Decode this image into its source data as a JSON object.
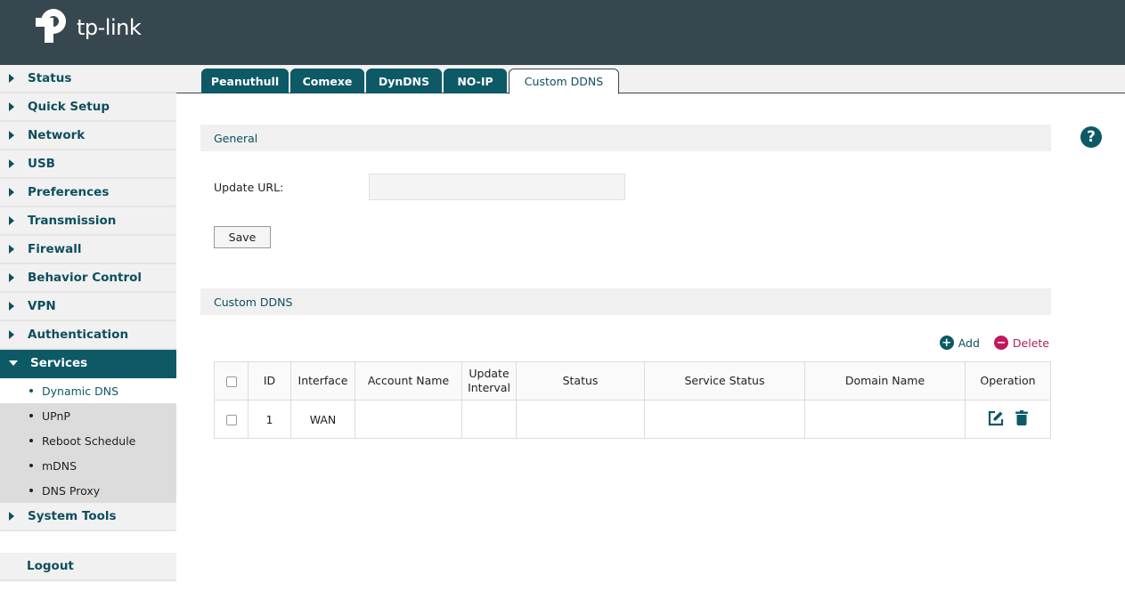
{
  "brand": {
    "name": "tp-link"
  },
  "sidebar": {
    "items": [
      {
        "label": "Status"
      },
      {
        "label": "Quick Setup"
      },
      {
        "label": "Network"
      },
      {
        "label": "USB"
      },
      {
        "label": "Preferences"
      },
      {
        "label": "Transmission"
      },
      {
        "label": "Firewall"
      },
      {
        "label": "Behavior Control"
      },
      {
        "label": "VPN"
      },
      {
        "label": "Authentication"
      },
      {
        "label": "Services",
        "expanded": true
      },
      {
        "label": "System Tools"
      }
    ],
    "services_sub": [
      {
        "label": "Dynamic DNS",
        "selected": true
      },
      {
        "label": "UPnP"
      },
      {
        "label": "Reboot Schedule"
      },
      {
        "label": "mDNS"
      },
      {
        "label": "DNS Proxy"
      }
    ],
    "logout": "Logout"
  },
  "tabs": [
    {
      "label": "Peanuthull"
    },
    {
      "label": "Comexe"
    },
    {
      "label": "DynDNS"
    },
    {
      "label": "NO-IP"
    },
    {
      "label": "Custom DDNS",
      "active": true
    }
  ],
  "general": {
    "title": "General",
    "update_url_label": "Update URL:",
    "update_url_value": "",
    "save_label": "Save"
  },
  "help": {
    "icon": "question-icon",
    "glyph": "?"
  },
  "custom_ddns": {
    "title": "Custom DDNS",
    "add_label": "Add",
    "delete_label": "Delete",
    "columns": [
      "",
      "ID",
      "Interface",
      "Account Name",
      "Update Interval",
      "Status",
      "Service Status",
      "Domain Name",
      "Operation"
    ],
    "rows": [
      {
        "id": "1",
        "interface": "WAN",
        "account_name": "",
        "update_interval": "",
        "status": "",
        "service_status": "",
        "domain_name": ""
      }
    ]
  },
  "colors": {
    "header": "#37474f",
    "accent": "#0d5966",
    "delete": "#c2185b"
  }
}
